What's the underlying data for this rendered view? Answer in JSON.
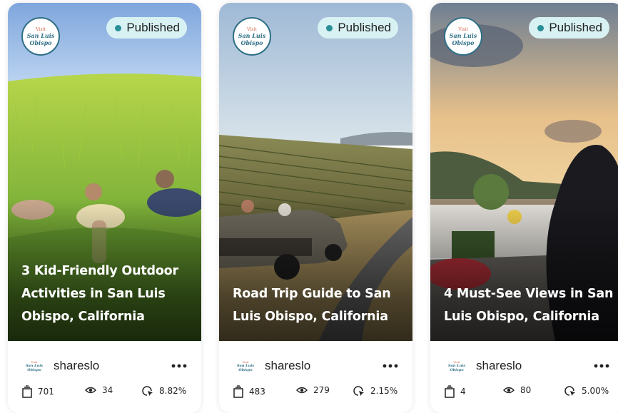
{
  "cards": [
    {
      "status": "Published",
      "title": "3 Kid-Friendly Outdoor Activities in San Luis Obispo, California",
      "author": "shareslo",
      "stats": {
        "pages": "701",
        "views": "34",
        "tap_rate": "8.82%"
      }
    },
    {
      "status": "Published",
      "title": "Road Trip Guide to San Luis Obispo, California",
      "author": "shareslo",
      "stats": {
        "pages": "483",
        "views": "279",
        "tap_rate": "2.15%"
      }
    },
    {
      "status": "Published",
      "title": "4 Must-See Views in San Luis Obispo, California",
      "author": "shareslo",
      "stats": {
        "pages": "4",
        "views": "80",
        "tap_rate": "5.00%"
      }
    }
  ],
  "brand_logo": {
    "line1": "Visit",
    "line2": "San Luis Obispo"
  },
  "icons": {
    "more": "more-dots-icon",
    "pages": "pages-stack-icon",
    "views": "eye-icon",
    "tap_rate": "tap-cursor-icon"
  },
  "colors": {
    "badge_bg": "#d8f1f3",
    "badge_dot": "#2a8f97",
    "brand_teal": "#2f6f86",
    "brand_coral": "#d9674a"
  }
}
